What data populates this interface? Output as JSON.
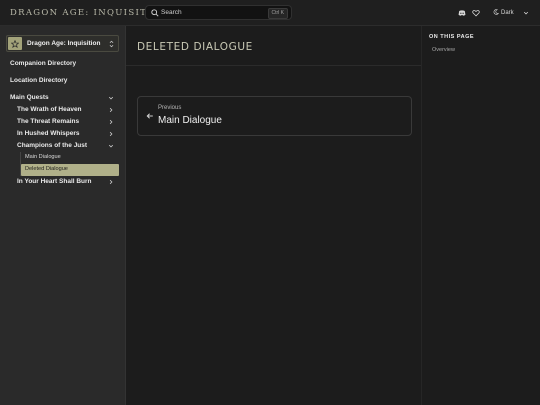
{
  "header": {
    "brand": "DRAGON AGE: INQUISITION",
    "search_label": "Search",
    "search_shortcut": "Ctrl K",
    "theme_label": "Dark"
  },
  "sidebar": {
    "site_name": "Dragon Age: Inquisition",
    "items": [
      {
        "label": "Companion Directory"
      },
      {
        "label": "Location Directory"
      },
      {
        "label": "Main Quests"
      }
    ],
    "quests": [
      {
        "label": "The Wrath of Heaven"
      },
      {
        "label": "The Threat Remains"
      },
      {
        "label": "In Hushed Whispers"
      },
      {
        "label": "Champions of the Just"
      },
      {
        "label": "In Your Heart Shall Burn"
      }
    ],
    "sub_items": [
      {
        "label": "Main Dialogue"
      },
      {
        "label": "Deleted Dialogue"
      }
    ]
  },
  "main": {
    "title": "DELETED DIALOGUE",
    "prev_label": "Previous",
    "prev_title": "Main Dialogue"
  },
  "toc": {
    "heading": "ON THIS PAGE",
    "links": [
      {
        "label": "Overview"
      }
    ]
  },
  "colors": {
    "accent": "#b0b089",
    "background": "#1c1c1c",
    "sidebar": "#2a2a2a"
  }
}
